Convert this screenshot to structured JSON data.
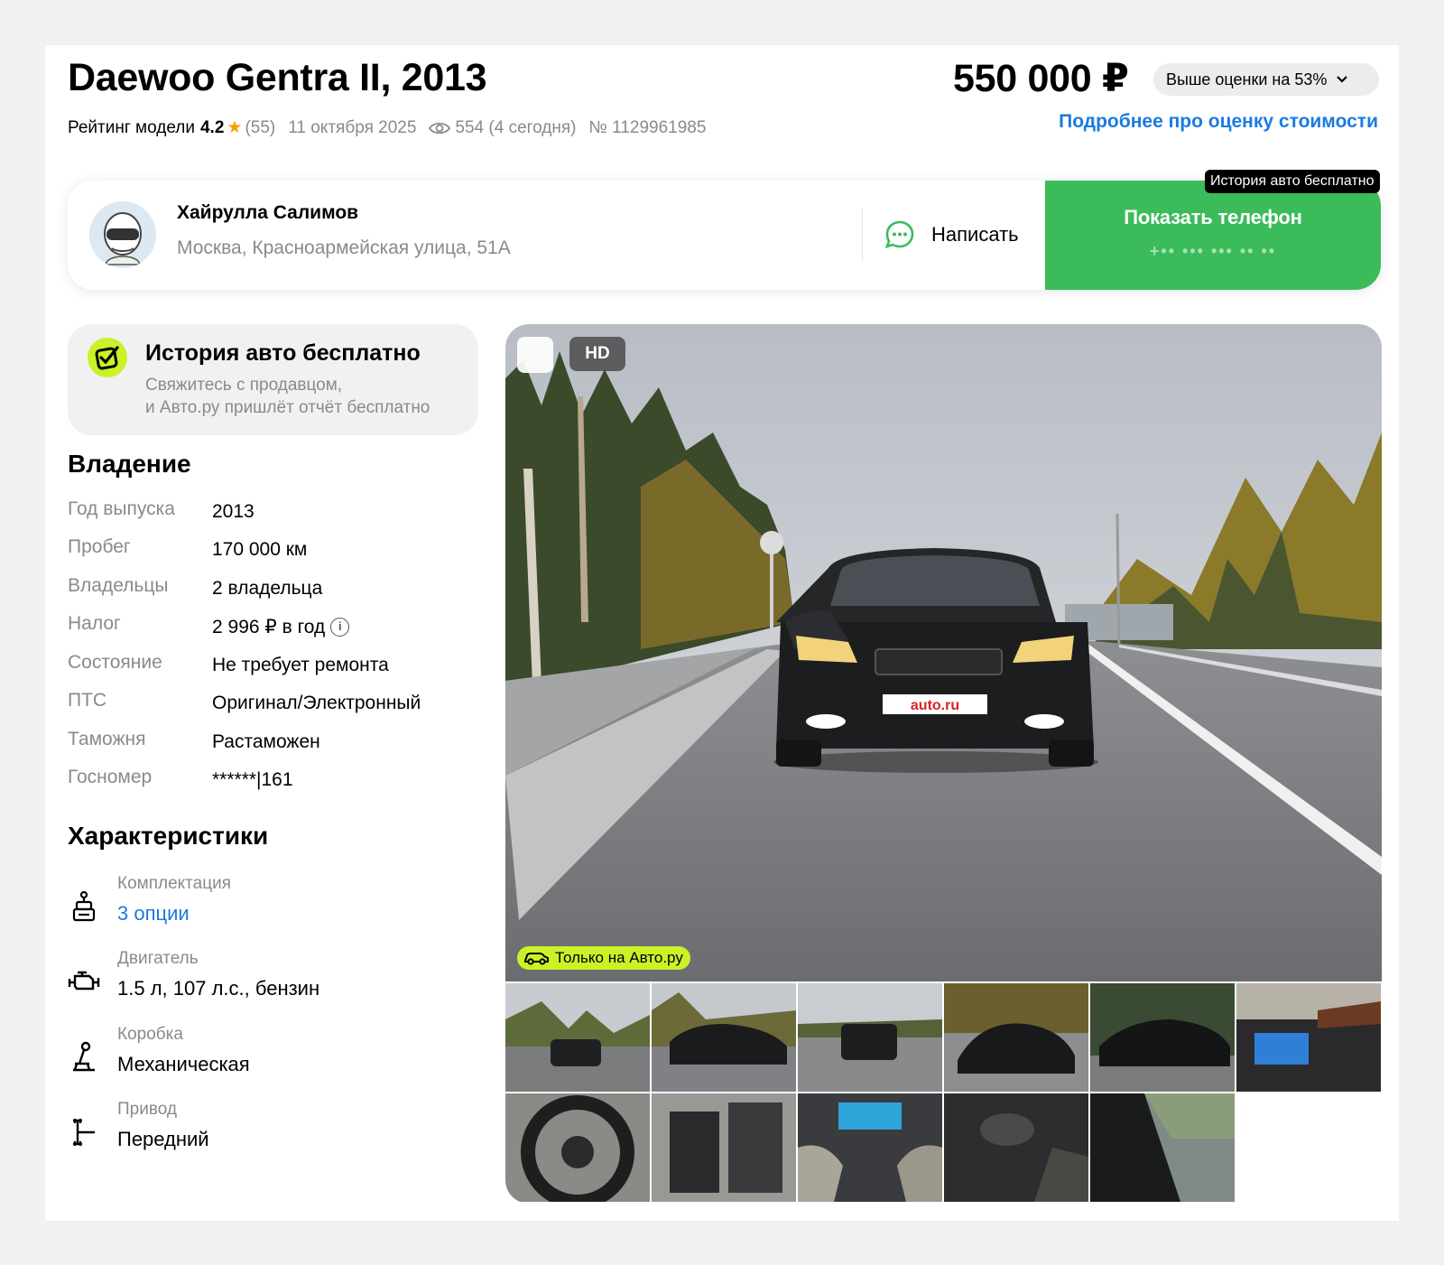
{
  "listing": {
    "title": "Daewoo Gentra II, 2013",
    "rating_label": "Рейтинг модели",
    "rating_value": "4.2",
    "rating_count": "(55)",
    "date": "11 октября 2025",
    "views": "554 (4 сегодня)",
    "number": "№ 1129961985"
  },
  "price": {
    "value": "550 000 ₽",
    "badge": "Выше оценки на 53%",
    "link": "Подробнее про оценку стоимости"
  },
  "seller": {
    "name": "Хайрулла Салимов",
    "address": "Москва, Красноармейская улица, 51А",
    "chat_label": "Написать",
    "phone_button": "Показать телефон",
    "phone_masked": "+•• ••• ••• •• ••",
    "tooltip": "История авто бесплатно"
  },
  "history": {
    "title": "История авто бесплатно",
    "line1": "Свяжитесь с продавцом,",
    "line2": "и Авто.ру пришлёт отчёт бесплатно"
  },
  "ownership": {
    "heading": "Владение",
    "rows": [
      {
        "key": "Год выпуска",
        "value": "2013"
      },
      {
        "key": "Пробег",
        "value": "170 000 км"
      },
      {
        "key": "Владельцы",
        "value": "2 владельца"
      },
      {
        "key": "Налог",
        "value": "2 996 ₽ в год"
      },
      {
        "key": "Состояние",
        "value": "Не требует ремонта"
      },
      {
        "key": "ПТС",
        "value": "Оригинал/Электронный"
      },
      {
        "key": "Таможня",
        "value": "Растаможен"
      },
      {
        "key": "Госномер",
        "value": "******|161"
      }
    ]
  },
  "specs": {
    "heading": "Характеристики",
    "items": [
      {
        "label": "Комплектация",
        "value": "3 опции",
        "icon": "equipment-icon"
      },
      {
        "label": "Двигатель",
        "value": "1.5 л, 107 л.с., бензин",
        "icon": "engine-icon"
      },
      {
        "label": "Коробка",
        "value": "Механическая",
        "icon": "gearbox-icon"
      },
      {
        "label": "Привод",
        "value": "Передний",
        "icon": "drive-icon"
      }
    ]
  },
  "gallery": {
    "hd_badge": "HD",
    "only_badge": "Только на Авто.ру",
    "plate_text": "auto.ru",
    "thumbnail_count": 11
  },
  "colors": {
    "green": "#3bbb5a",
    "link": "#1b7be0",
    "lime": "#c9f227"
  }
}
